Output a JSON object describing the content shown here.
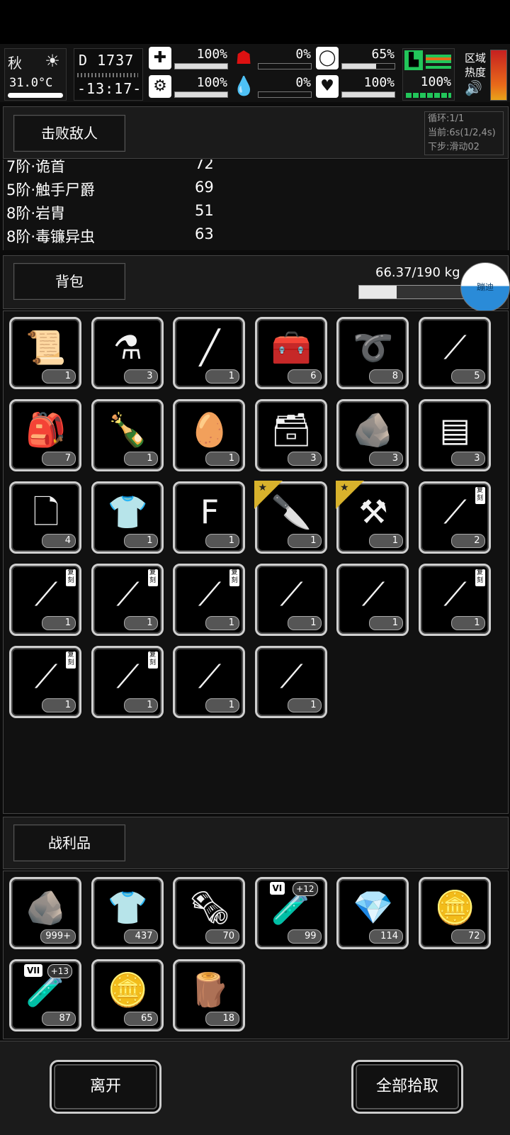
{
  "status": {
    "season": "秋",
    "temperature": "31.0°C",
    "day": "1737",
    "time": "-13:17-",
    "stats": [
      {
        "icon": "medkit-icon",
        "glyph": "✚",
        "value": "100%",
        "fill": 1.0
      },
      {
        "icon": "stomach-icon",
        "glyph": "☗",
        "value": "0%",
        "fill": 0.0
      },
      {
        "icon": "tooth-icon",
        "glyph": "◯",
        "value": "65%",
        "fill": 0.65
      },
      {
        "icon": "brain-icon",
        "glyph": "⚙",
        "value": "100%",
        "fill": 1.0
      },
      {
        "icon": "blood-drop-icon",
        "glyph": "💧",
        "value": "0%",
        "fill": 0.0
      },
      {
        "icon": "heart-icon",
        "glyph": "♥",
        "value": "100%",
        "fill": 1.0
      }
    ],
    "stamina": "100%",
    "zone_label": "区域热度",
    "colors": {
      "green": "#22c65a",
      "orange": "#e66a18",
      "red": "#d11"
    }
  },
  "defeated": {
    "title": "击败敌人",
    "log": [
      "循环:1/1",
      "当前:6s(1/2,4s)",
      "下步:滑动02"
    ],
    "enemies": [
      {
        "name": "7阶·诡首",
        "count": "72"
      },
      {
        "name": "5阶·触手尸爵",
        "count": "69"
      },
      {
        "name": "8阶·岩胄",
        "count": "51"
      },
      {
        "name": "8阶·毒镰异虫",
        "count": "63"
      }
    ]
  },
  "backpack": {
    "title": "背包",
    "weight": "66.37/190 kg",
    "weight_fraction": 0.35,
    "bouncy_label": "蹦迪",
    "items": [
      {
        "icon": "scroll-icon",
        "glyph": "📜",
        "count": "1"
      },
      {
        "icon": "spray-cans-icon",
        "glyph": "⚗",
        "count": "3"
      },
      {
        "icon": "stick-icon",
        "glyph": "╱",
        "count": "1"
      },
      {
        "icon": "toolbox-icon",
        "glyph": "🧰",
        "count": "6"
      },
      {
        "icon": "rope-icon",
        "glyph": "➰",
        "count": "8"
      },
      {
        "icon": "tweezers-icon",
        "glyph": "⟋",
        "count": "5"
      },
      {
        "icon": "tool-bag-icon",
        "glyph": "🎒",
        "count": "7"
      },
      {
        "icon": "bottle-icon",
        "glyph": "🍾",
        "count": "1"
      },
      {
        "icon": "seeds-icon",
        "glyph": "🥚",
        "count": "1"
      },
      {
        "icon": "pliers-box-icon",
        "glyph": "🗃",
        "count": "3"
      },
      {
        "icon": "ore-icon",
        "glyph": "🪨",
        "count": "3"
      },
      {
        "icon": "cloth-icon",
        "glyph": "▤",
        "count": "3"
      },
      {
        "icon": "paper-icon",
        "glyph": "🗋",
        "count": "4"
      },
      {
        "icon": "ragged-shirt-icon",
        "glyph": "👕",
        "count": "1"
      },
      {
        "icon": "feed-bag-icon",
        "glyph": "F",
        "count": "1"
      },
      {
        "icon": "caliper-knife-icon",
        "glyph": "🔪",
        "count": "1",
        "star": true
      },
      {
        "icon": "shovel-icon",
        "glyph": "⚒",
        "count": "1",
        "star": true
      },
      {
        "icon": "spear-icon",
        "glyph": "⟋",
        "count": "2",
        "tag": "复刻"
      },
      {
        "icon": "spear-icon",
        "glyph": "⟋",
        "count": "1",
        "tag": "复刻"
      },
      {
        "icon": "spear-icon",
        "glyph": "⟋",
        "count": "1",
        "tag": "复刻"
      },
      {
        "icon": "spear-icon",
        "glyph": "⟋",
        "count": "1",
        "tag": "复刻"
      },
      {
        "icon": "spear-icon",
        "glyph": "⟋",
        "count": "1"
      },
      {
        "icon": "spear-icon",
        "glyph": "⟋",
        "count": "1"
      },
      {
        "icon": "spear-icon",
        "glyph": "⟋",
        "count": "1",
        "tag": "复刻"
      },
      {
        "icon": "spear-icon",
        "glyph": "⟋",
        "count": "1",
        "tag": "复刻"
      },
      {
        "icon": "spear-icon",
        "glyph": "⟋",
        "count": "1",
        "tag": "复刻"
      },
      {
        "icon": "hook-spear-icon",
        "glyph": "⟋",
        "count": "1"
      },
      {
        "icon": "spear-icon",
        "glyph": "⟋",
        "count": "1"
      }
    ]
  },
  "loot": {
    "title": "战利品",
    "items": [
      {
        "icon": "ore-icon",
        "glyph": "🪨",
        "count": "999+"
      },
      {
        "icon": "ragged-shirt-icon",
        "glyph": "👕",
        "count": "437"
      },
      {
        "icon": "paper-roll-icon",
        "glyph": "🗞",
        "count": "70"
      },
      {
        "icon": "vial-icon",
        "glyph": "🧪",
        "count": "99",
        "badge": "VI",
        "plus": "+12"
      },
      {
        "icon": "gold-crystal-icon",
        "glyph": "💎",
        "count": "114",
        "color": "yellow"
      },
      {
        "icon": "gold-coil-icon",
        "glyph": "🪙",
        "count": "72",
        "color": "orange"
      },
      {
        "icon": "vial-icon",
        "glyph": "🧪",
        "count": "87",
        "badge": "VII",
        "plus": "+13"
      },
      {
        "icon": "gold-ore-icon",
        "glyph": "🪙",
        "count": "65",
        "color": "orange"
      },
      {
        "icon": "log-icon",
        "glyph": "🪵",
        "count": "18"
      }
    ]
  },
  "actions": {
    "leave": "离开",
    "pickup_all": "全部拾取"
  }
}
